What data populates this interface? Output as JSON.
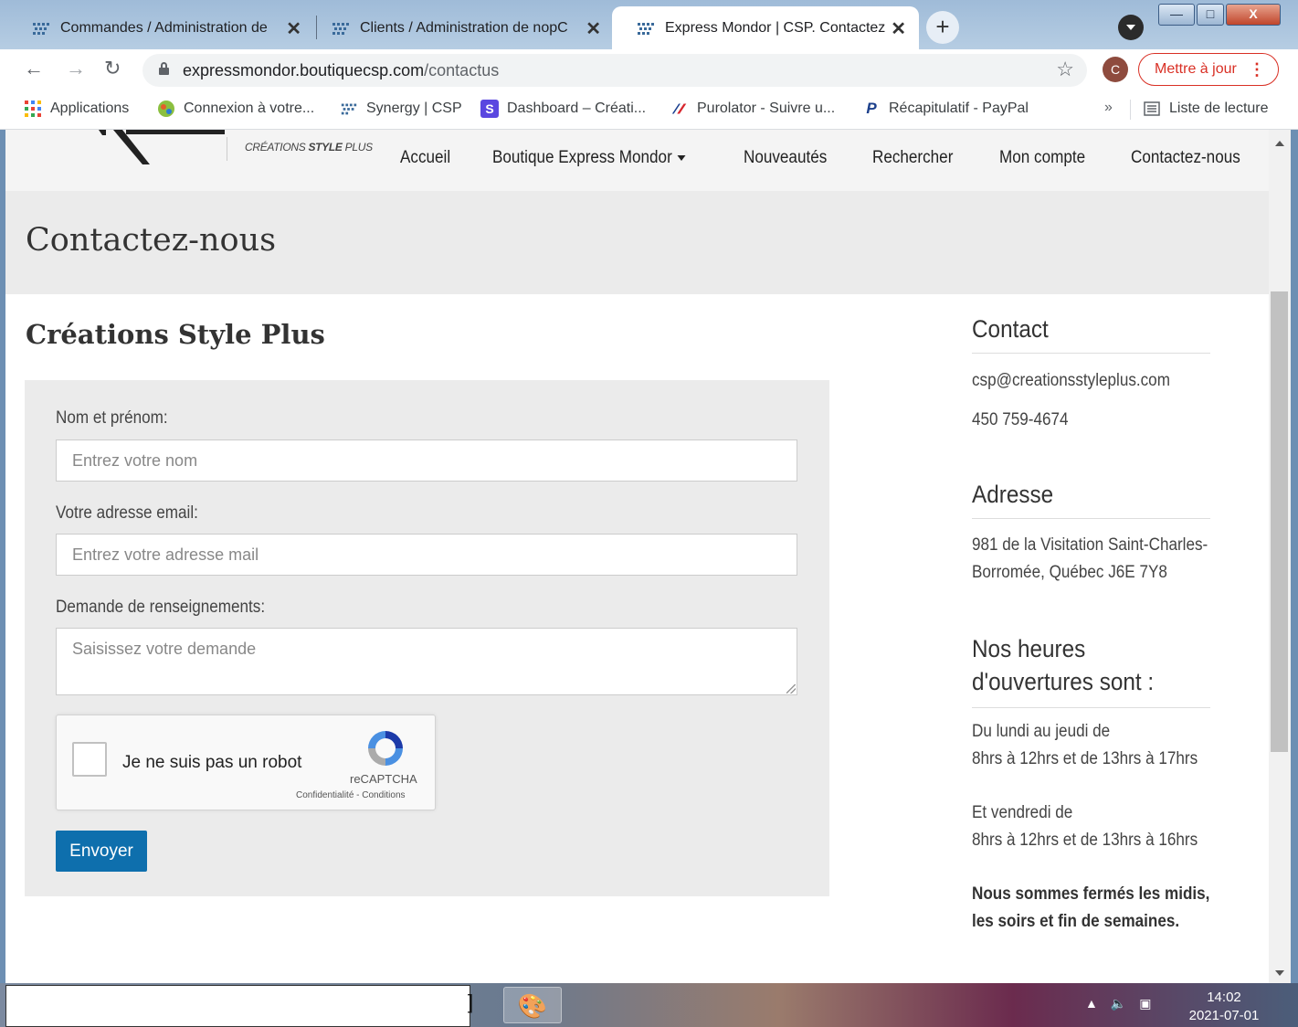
{
  "browser": {
    "tabs": [
      {
        "title": "Commandes / Administration de",
        "active": false
      },
      {
        "title": "Clients / Administration de nopC",
        "active": false
      },
      {
        "title": "Express Mondor | CSP. Contactez",
        "active": true
      }
    ],
    "new_tab_symbol": "+",
    "close_symbol": "✕",
    "window_controls": {
      "minimize": "—",
      "maximize": "□",
      "close": "X"
    },
    "url_host": "expressmondor.boutiquecsp.com",
    "url_path": "/contactus",
    "avatar_letter": "C",
    "update_button": "Mettre à jour",
    "bookmarks": [
      {
        "label": "Applications",
        "icon": "apps-grid-icon"
      },
      {
        "label": "Connexion à votre...",
        "icon": "globe-icon"
      },
      {
        "label": "Synergy | CSP",
        "icon": "synergy-icon"
      },
      {
        "label": "Dashboard – Créati...",
        "icon": "s-icon"
      },
      {
        "label": "Purolator - Suivre u...",
        "icon": "purolator-icon"
      },
      {
        "label": "Récapitulatif - PayPal",
        "icon": "paypal-icon"
      }
    ],
    "bookmarks_more": "»",
    "reading_list": "Liste de lecture"
  },
  "site": {
    "logo_tagline_pre": "CRÉATIONS ",
    "logo_tagline_bold": "STYLE",
    "logo_tagline_post": " PLUS",
    "nav": [
      "Accueil",
      "Boutique Express Mondor",
      "Nouveautés",
      "Rechercher",
      "Mon compte",
      "Contactez-nous"
    ]
  },
  "page": {
    "title": "Contactez-nous",
    "section_title": "Créations Style Plus"
  },
  "form": {
    "name_label": "Nom et prénom:",
    "name_placeholder": "Entrez votre nom",
    "email_label": "Votre adresse email:",
    "email_placeholder": "Entrez votre adresse mail",
    "message_label": "Demande de renseignements:",
    "message_placeholder": "Saisissez votre demande",
    "captcha_label": "Je ne suis pas un robot",
    "captcha_brand": "reCAPTCHA",
    "captcha_links": "Confidentialité - Conditions",
    "submit": "Envoyer"
  },
  "sidebar": {
    "contact_heading": "Contact",
    "email": "csp@creationsstyleplus.com",
    "phone": "450 759-4674",
    "address_heading": "Adresse",
    "address_line1": "981 de la Visitation Saint-Charles-",
    "address_line2": "Borromée, Québec J6E 7Y8",
    "hours_heading": "Nos heures d'ouvertures sont :",
    "hours_weekdays_label": "Du lundi au jeudi de",
    "hours_weekdays": "8hrs à 12hrs et de 13hrs à 17hrs",
    "hours_friday_label": "Et vendredi de",
    "hours_friday": "8hrs à 12hrs et de 13hrs à 16hrs",
    "closed_line1": "Nous sommes fermés les midis,",
    "closed_line2": "les soirs et fin de semaines."
  },
  "taskbar": {
    "time": "14:02",
    "date": "2021-07-01"
  },
  "colors": {
    "accent_button": "#0e6fad",
    "update_red": "#d93025",
    "panel_gray": "#ebebeb"
  }
}
